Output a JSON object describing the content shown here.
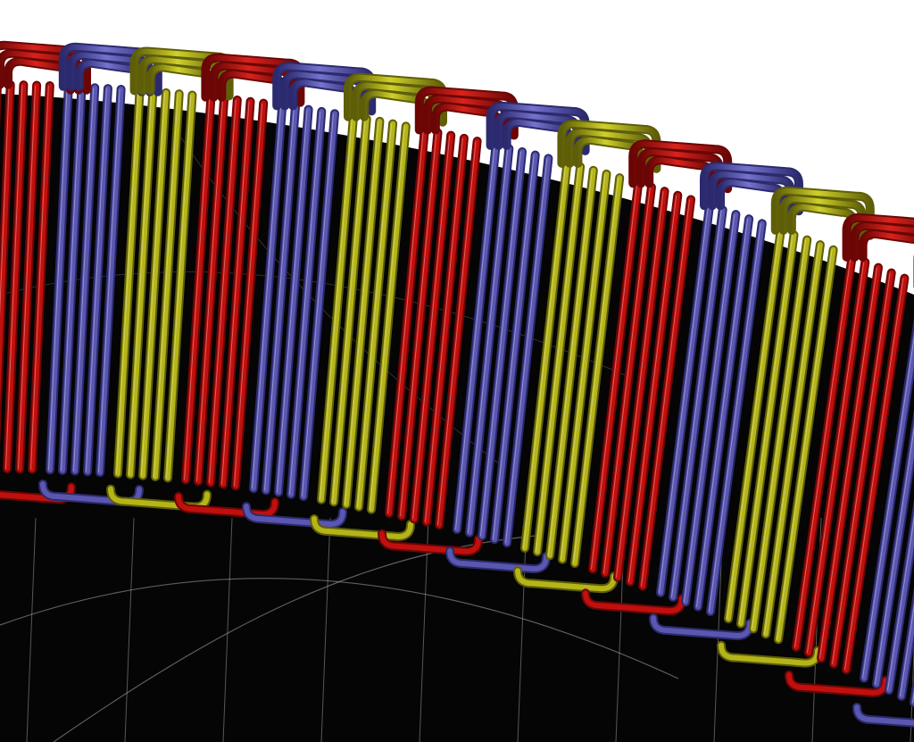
{
  "scene": {
    "subject": "stator-winding-3d-render",
    "background_color": "#ffffff",
    "core_color": "#050505",
    "mesh_line_color": "#9a9a9a",
    "phase_colors": {
      "red": "#c0100d",
      "red_dark": "#6a0605",
      "blue": "#5a57b0",
      "blue_dark": "#2c2a6e",
      "yellow": "#b5b51a",
      "yellow_dark": "#5e5e08"
    },
    "phase_sequence": [
      "red",
      "blue",
      "yellow"
    ],
    "conductors_per_group": 5
  }
}
